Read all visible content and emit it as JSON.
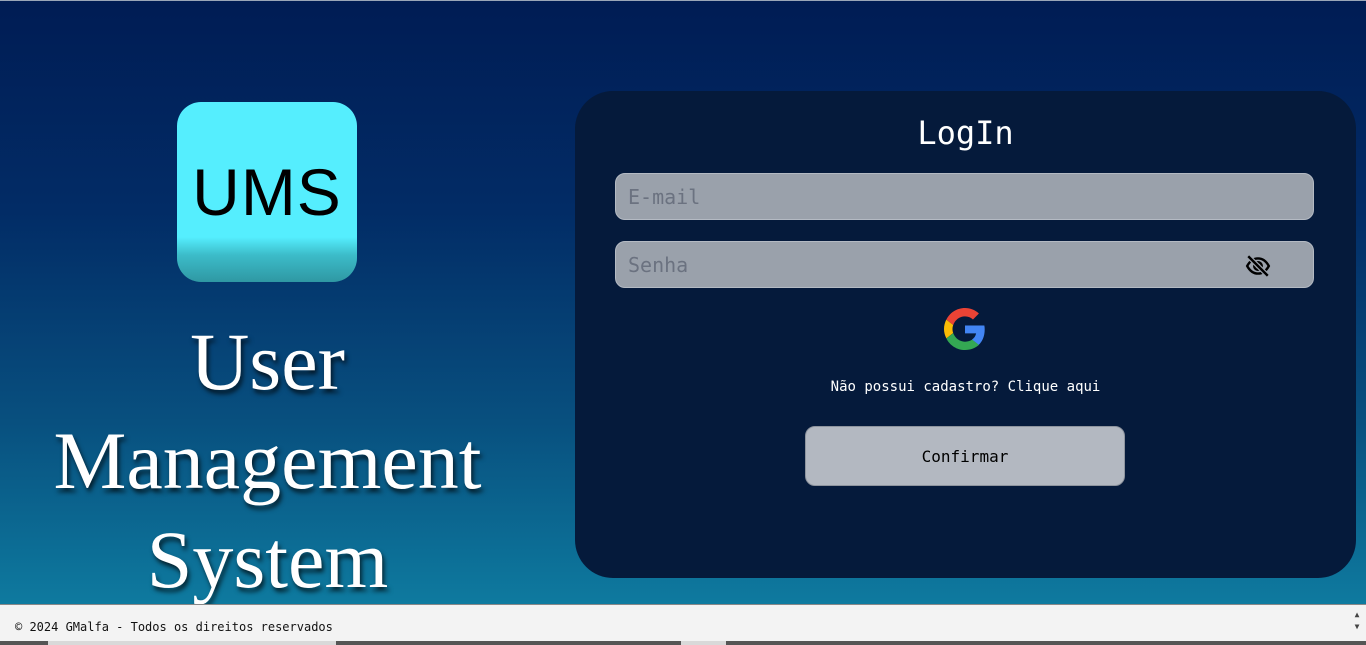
{
  "brand": {
    "logo_text": "UMS",
    "title_lines": [
      "User",
      "Management",
      "System"
    ]
  },
  "login": {
    "title": "LogIn",
    "email_placeholder": "E-mail",
    "password_placeholder": "Senha",
    "password_toggle_icon": "eye-off-icon",
    "google_icon": "google-icon",
    "signup_text": "Não possui cadastro? Clique aqui",
    "confirm_label": "Confirmar"
  },
  "footer": {
    "text": "© 2024 GMalfa - Todos os direitos reservados"
  },
  "colors": {
    "bg_top": "#001c54",
    "bg_bottom": "#0e7a9f",
    "card": "#051a3b",
    "logo": "#55eefe",
    "field": "#9aa1ab",
    "button": "#b3b8c1"
  }
}
